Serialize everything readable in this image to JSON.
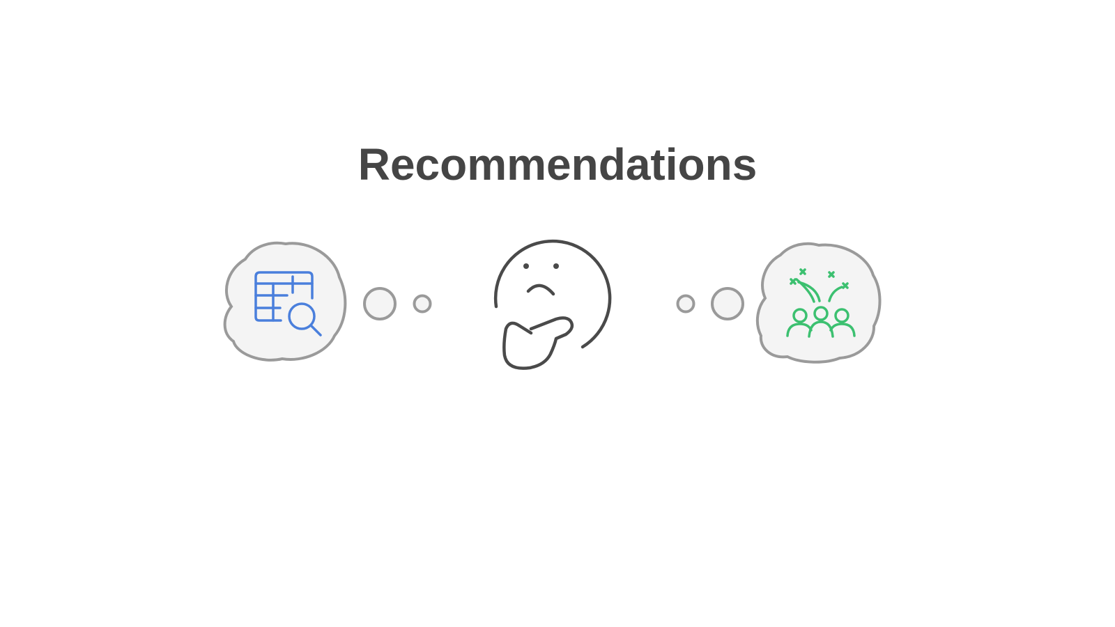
{
  "title": "Recommendations",
  "colors": {
    "title": "#454545",
    "outline": "#9a9a9a",
    "bubble_fill": "#f4f4f4",
    "face_stroke": "#4a4a4a",
    "table_icon": "#4a7fdc",
    "celebration_icon": "#3cc070"
  },
  "icons": {
    "left_thought": "table-search-icon",
    "center": "thinking-face-icon",
    "right_thought": "celebration-group-icon"
  }
}
